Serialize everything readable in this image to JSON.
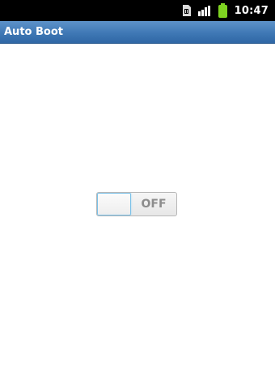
{
  "status_bar": {
    "time": "10:47",
    "icons": [
      "sim-card-icon",
      "signal-bars-icon",
      "battery-icon"
    ],
    "battery_color": "#7ed321"
  },
  "app_bar": {
    "title": "Auto Boot",
    "accent": "#3f78b5"
  },
  "toggle": {
    "state_label": "OFF",
    "checked": false,
    "highlight_color": "#79c0e8"
  }
}
